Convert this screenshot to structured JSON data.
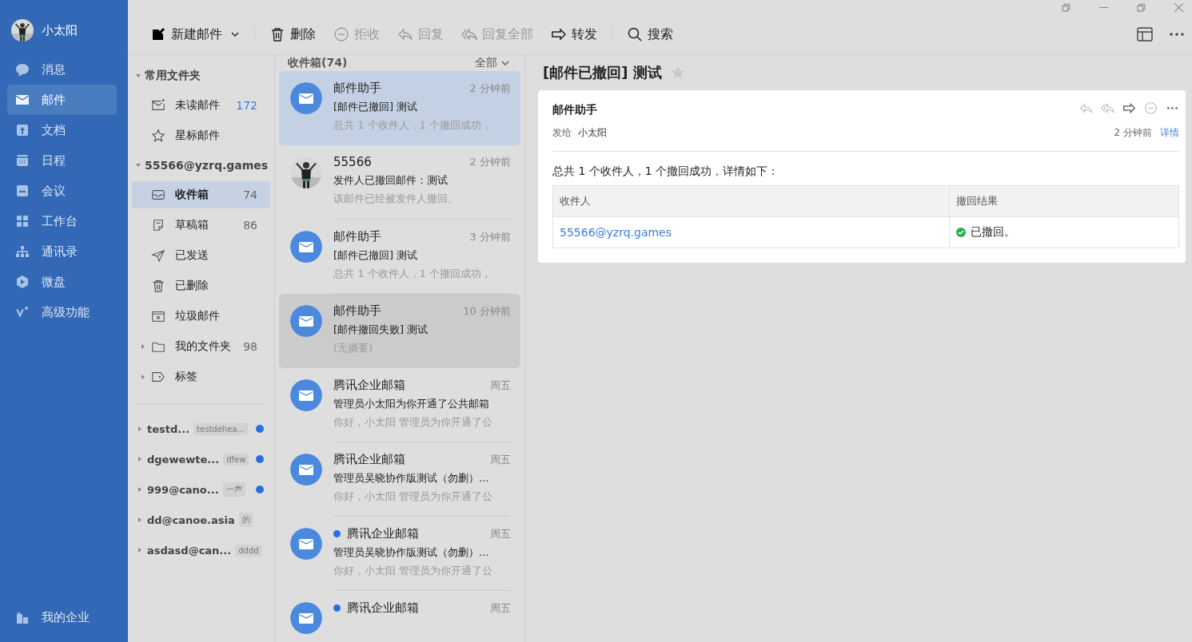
{
  "user": {
    "name": "小太阳"
  },
  "nav": [
    {
      "label": "消息",
      "kind": "chat",
      "selected": false
    },
    {
      "label": "邮件",
      "kind": "mail",
      "selected": true
    },
    {
      "label": "文档",
      "kind": "doc",
      "selected": false
    },
    {
      "label": "日程",
      "kind": "calendar",
      "selected": false
    },
    {
      "label": "会议",
      "kind": "meeting",
      "selected": false
    },
    {
      "label": "工作台",
      "kind": "grid",
      "selected": false
    },
    {
      "label": "通讯录",
      "kind": "org",
      "selected": false
    },
    {
      "label": "微盘",
      "kind": "drive",
      "selected": false
    },
    {
      "label": "高级功能",
      "kind": "spark",
      "selected": false
    }
  ],
  "nav_bottom": {
    "label": "我的企业"
  },
  "toolbar": [
    {
      "label": "新建邮件",
      "kind": "compose",
      "disabled": false,
      "dropdown": true
    },
    {
      "label": "删除",
      "kind": "trash",
      "disabled": false,
      "dropdown": false
    },
    {
      "label": "拒收",
      "kind": "block",
      "disabled": true,
      "dropdown": false
    },
    {
      "label": "回复",
      "kind": "reply",
      "disabled": true,
      "dropdown": false
    },
    {
      "label": "回复全部",
      "kind": "replyall",
      "disabled": true,
      "dropdown": false
    },
    {
      "label": "转发",
      "kind": "forward",
      "disabled": false,
      "dropdown": false
    },
    {
      "label": "搜索",
      "kind": "search",
      "disabled": false,
      "dropdown": false
    }
  ],
  "folders": {
    "favorites_title": "常用文件夹",
    "favorites": [
      {
        "label": "未读邮件",
        "kind": "unread",
        "count": "172",
        "accent": true,
        "selected": false
      },
      {
        "label": "星标邮件",
        "kind": "star",
        "selected": false
      }
    ],
    "account": "55566@yzrq.games",
    "items": [
      {
        "label": "收件箱",
        "kind": "inbox",
        "count": "74",
        "accent": false,
        "selected": true
      },
      {
        "label": "草稿箱",
        "kind": "draft",
        "count": "86",
        "accent": false,
        "selected": false
      },
      {
        "label": "已发送",
        "kind": "send",
        "selected": false
      },
      {
        "label": "已删除",
        "kind": "trash",
        "selected": false
      },
      {
        "label": "垃圾邮件",
        "kind": "spam",
        "selected": false
      },
      {
        "label": "我的文件夹",
        "kind": "folder",
        "count": "98",
        "accent": false,
        "selected": false,
        "expandable": true
      },
      {
        "label": "标签",
        "kind": "tag",
        "selected": false,
        "expandable": true
      }
    ],
    "accounts": [
      {
        "name": "testd...",
        "tag": "testdehea...",
        "unread": true
      },
      {
        "name": "dgewewte...",
        "tag": "dfew",
        "unread": true
      },
      {
        "name": "999@cano...",
        "tag": "一声",
        "unread": true
      },
      {
        "name": "dd@canoe.asia",
        "tag": "的",
        "unread": false
      },
      {
        "name": "asdasd@can...",
        "tag": "dddd",
        "unread": false
      }
    ]
  },
  "list": {
    "title": "收件箱(74)",
    "filter": "全部",
    "messages": [
      {
        "kind": "mail",
        "sender": "邮件助手",
        "time": "2 分钟前",
        "subject": "[邮件已撤回] 测试",
        "preview": "总共 1 个收件人，1 个撤回成功，",
        "selected": true,
        "hovered": false,
        "unread": false
      },
      {
        "sender": "55566",
        "time": "2 分钟前",
        "subject": "发件人已撤回邮件：测试",
        "preview": "该邮件已经被发件人撤回。",
        "selected": false,
        "hovered": false,
        "unread": false
      },
      {
        "kind": "mail",
        "sender": "邮件助手",
        "time": "3 分钟前",
        "subject": "[邮件已撤回] 测试",
        "preview": "总共 1 个收件人，1 个撤回成功，",
        "selected": false,
        "hovered": false,
        "unread": false
      },
      {
        "kind": "mail",
        "sender": "邮件助手",
        "time": "10 分钟前",
        "subject": "[邮件撤回失败] 测试",
        "preview": "(无摘要)",
        "selected": false,
        "hovered": true,
        "unread": false
      },
      {
        "kind": "mail",
        "sender": "腾讯企业邮箱",
        "time": "周五",
        "subject": "管理员小太阳为你开通了公共邮箱",
        "preview": "你好，小太阳 管理员为你开通了公",
        "selected": false,
        "hovered": false,
        "unread": false
      },
      {
        "kind": "mail",
        "sender": "腾讯企业邮箱",
        "time": "周五",
        "subject": "管理员吴晓协作版测试（勿删）...",
        "preview": "你好，小太阳 管理员为你开通了公",
        "selected": false,
        "hovered": false,
        "unread": false
      },
      {
        "kind": "mail",
        "sender": "腾讯企业邮箱",
        "time": "周五",
        "subject": "管理员吴晓协作版测试（勿删）...",
        "preview": "你好，小太阳 管理员为你开通了公",
        "selected": false,
        "hovered": false,
        "unread": true
      },
      {
        "kind": "mail",
        "sender": "腾讯企业邮箱",
        "time": "周五",
        "selected": false,
        "hovered": false,
        "unread": true
      }
    ]
  },
  "reader": {
    "subject": "[邮件已撤回] 测试",
    "starred": false,
    "from": "邮件助手",
    "to_label": "发给",
    "to": "小太阳",
    "time": "2 分钟前",
    "details": "详情",
    "body": "总共 1 个收件人，1 个撤回成功，详情如下：",
    "table": {
      "columns": [
        "收件人",
        "撤回结果"
      ],
      "rows": [
        {
          "recipient": "55566@yzrq.games",
          "result": "已撤回。",
          "success": true
        }
      ]
    }
  }
}
